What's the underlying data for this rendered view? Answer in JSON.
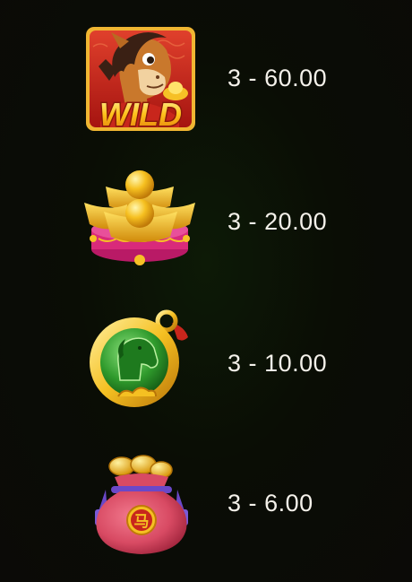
{
  "paytable": [
    {
      "symbol_icon": "wild-horse-icon",
      "symbol_label": "WILD",
      "min_count": "3",
      "separator": "-",
      "payout": "60.00"
    },
    {
      "symbol_icon": "gold-ingots-icon",
      "min_count": "3",
      "separator": "-",
      "payout": "20.00"
    },
    {
      "symbol_icon": "jade-horse-medallion-icon",
      "min_count": "3",
      "separator": "-",
      "payout": "10.00"
    },
    {
      "symbol_icon": "lucky-bag-icon",
      "bag_glyph": "马",
      "min_count": "3",
      "separator": "-",
      "payout": "6.00"
    }
  ],
  "colors": {
    "background": "#0b0d06",
    "text": "#f4f1ea",
    "gold": "#f5c022",
    "red": "#c8261c",
    "jade": "#2f9a2c",
    "pink": "#d84a63"
  }
}
